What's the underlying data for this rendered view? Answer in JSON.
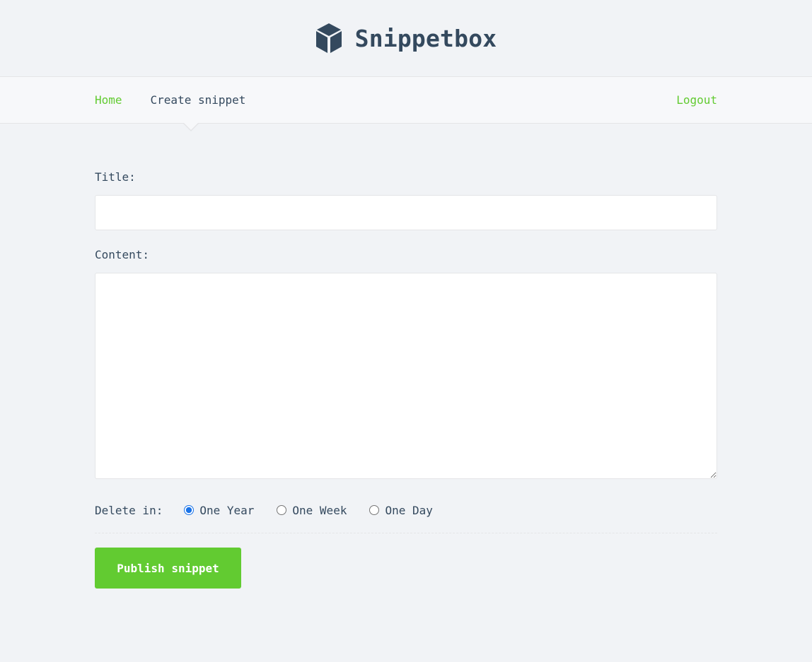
{
  "app": {
    "title": "Snippetbox",
    "logo_icon": "cube-icon",
    "brand_color": "#34495e",
    "accent_color": "#62cb31"
  },
  "nav": {
    "home_label": "Home",
    "create_label": "Create snippet",
    "logout_label": "Logout",
    "active": "Create snippet"
  },
  "form": {
    "title_label": "Title:",
    "title_value": "",
    "content_label": "Content:",
    "content_value": "",
    "delete_label": "Delete in:",
    "expires_options": [
      {
        "label": "One Year",
        "checked": true
      },
      {
        "label": "One Week",
        "checked": false
      },
      {
        "label": "One Day",
        "checked": false
      }
    ],
    "submit_label": "Publish snippet"
  }
}
